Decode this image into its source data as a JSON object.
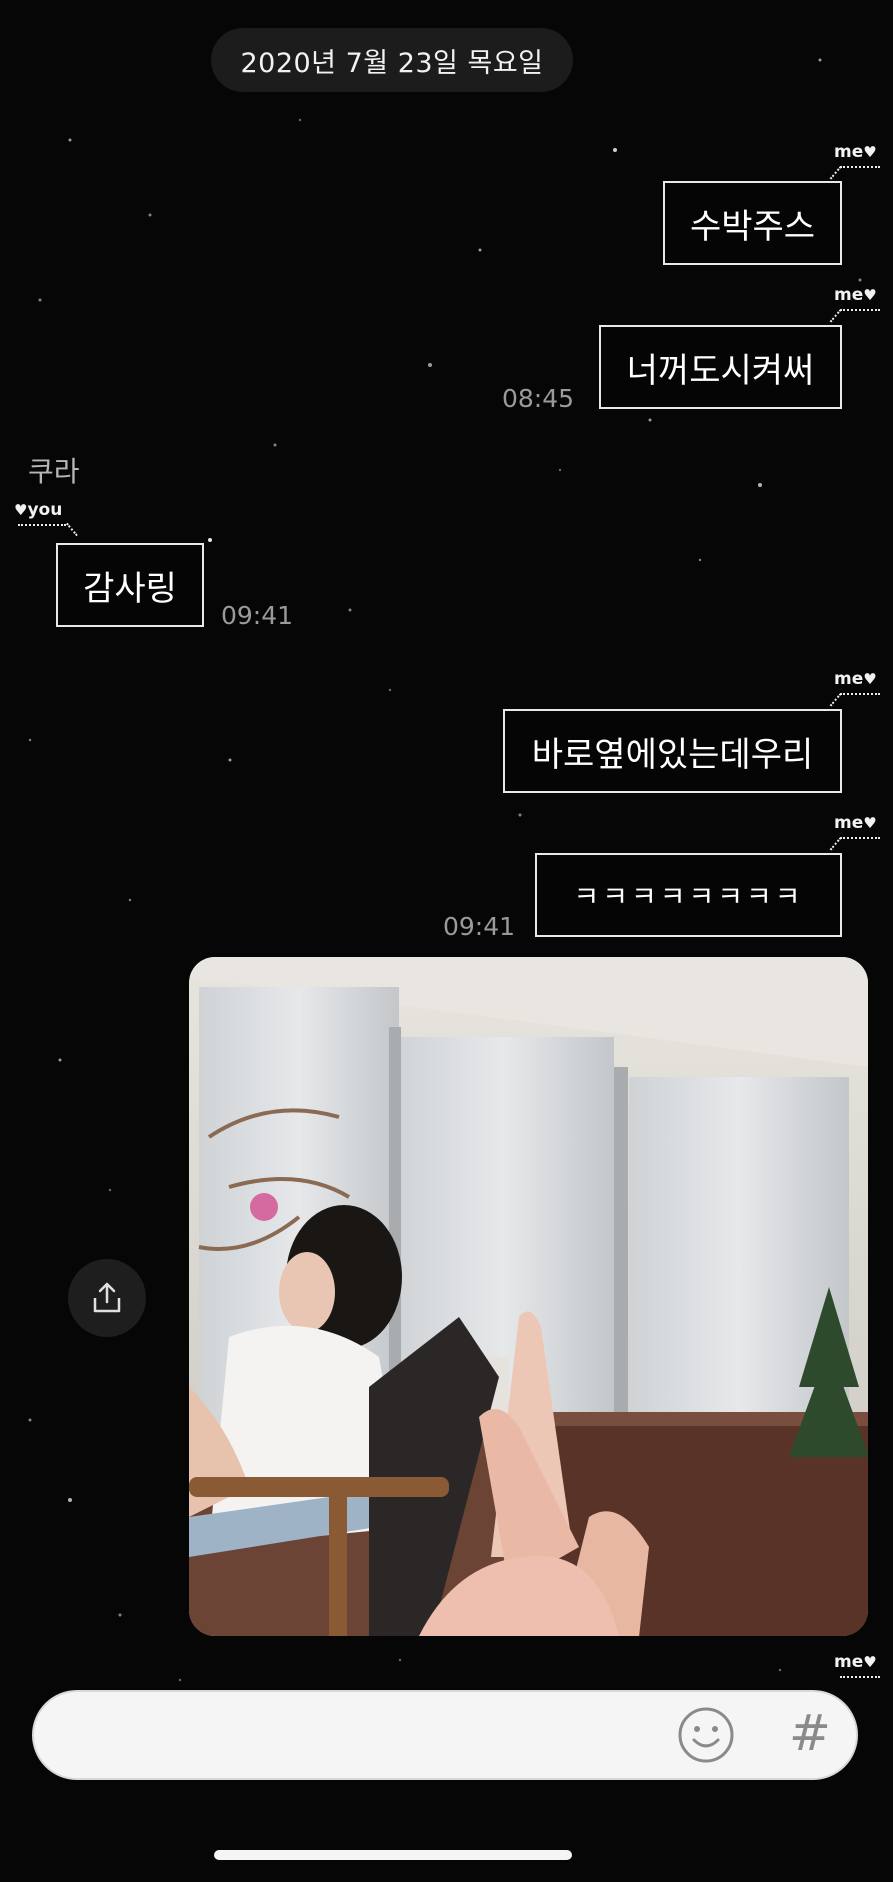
{
  "date_label": "2020년 7월 23일 목요일",
  "me_tag": "me",
  "you_tag": "you",
  "heart": "♥",
  "messages": [
    {
      "side": "me",
      "text": "수박주스"
    },
    {
      "side": "me",
      "text": "너꺼도시켜써",
      "time": "08:45"
    },
    {
      "side": "you",
      "sender": "쿠라",
      "text": "감사링",
      "time": "09:41"
    },
    {
      "side": "me",
      "text": "바로옆에있는데우리"
    },
    {
      "side": "me",
      "text": "ㅋㅋㅋㅋㅋㅋㅋㅋ",
      "time": "09:41"
    },
    {
      "side": "me",
      "type": "photo"
    }
  ],
  "input": {
    "emoji_icon": "smiley-icon",
    "hash_label": "#"
  },
  "icons": {
    "share": "share-icon",
    "emoji": "smiley-icon"
  },
  "colors": {
    "background": "#060606",
    "bubble_border": "#e8e8e8",
    "time": "#9a9a9a"
  }
}
